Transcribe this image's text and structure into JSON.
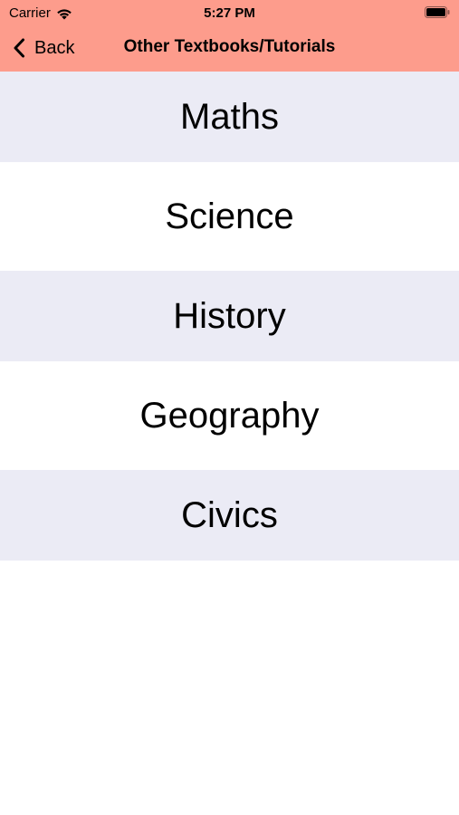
{
  "status_bar": {
    "carrier": "Carrier",
    "time": "5:27 PM",
    "wifi_icon": "wifi-icon",
    "battery_icon": "battery-icon"
  },
  "nav": {
    "back_label": "Back",
    "back_icon": "chevron-left-icon",
    "title": "Other Textbooks/Tutorials",
    "background": "#fd9c8c"
  },
  "subjects": [
    {
      "label": "Maths"
    },
    {
      "label": "Science"
    },
    {
      "label": "History"
    },
    {
      "label": "Geography"
    },
    {
      "label": "Civics"
    }
  ],
  "colors": {
    "row_tint": "#ebebf5",
    "row_plain": "#ffffff"
  }
}
